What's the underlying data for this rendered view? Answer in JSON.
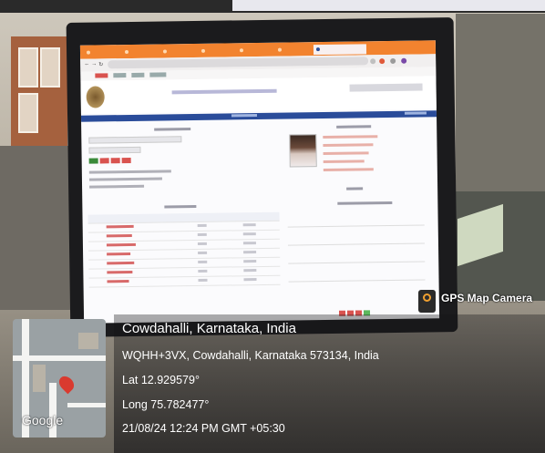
{
  "gps_stamp": {
    "app_label": "GPS Map Camera",
    "location_title": "Cowdahalli, Karnataka, India",
    "address": "WQHH+3VX, Cowdahalli, Karnataka 573134, India",
    "latitude": "Lat 12.929579°",
    "longitude": "Long 75.782477°",
    "timestamp": "21/08/24 12:24 PM GMT +05:30",
    "map_provider": "Google"
  },
  "colors": {
    "browser_tabbar": "#f2832f",
    "portal_bar": "#2a4c9a",
    "overlay_text": "#ffffff",
    "map_marker": "#d93a2f"
  },
  "icons": [
    "gps-camera-icon",
    "map-marker-icon",
    "back-icon",
    "forward-icon",
    "reload-icon"
  ]
}
